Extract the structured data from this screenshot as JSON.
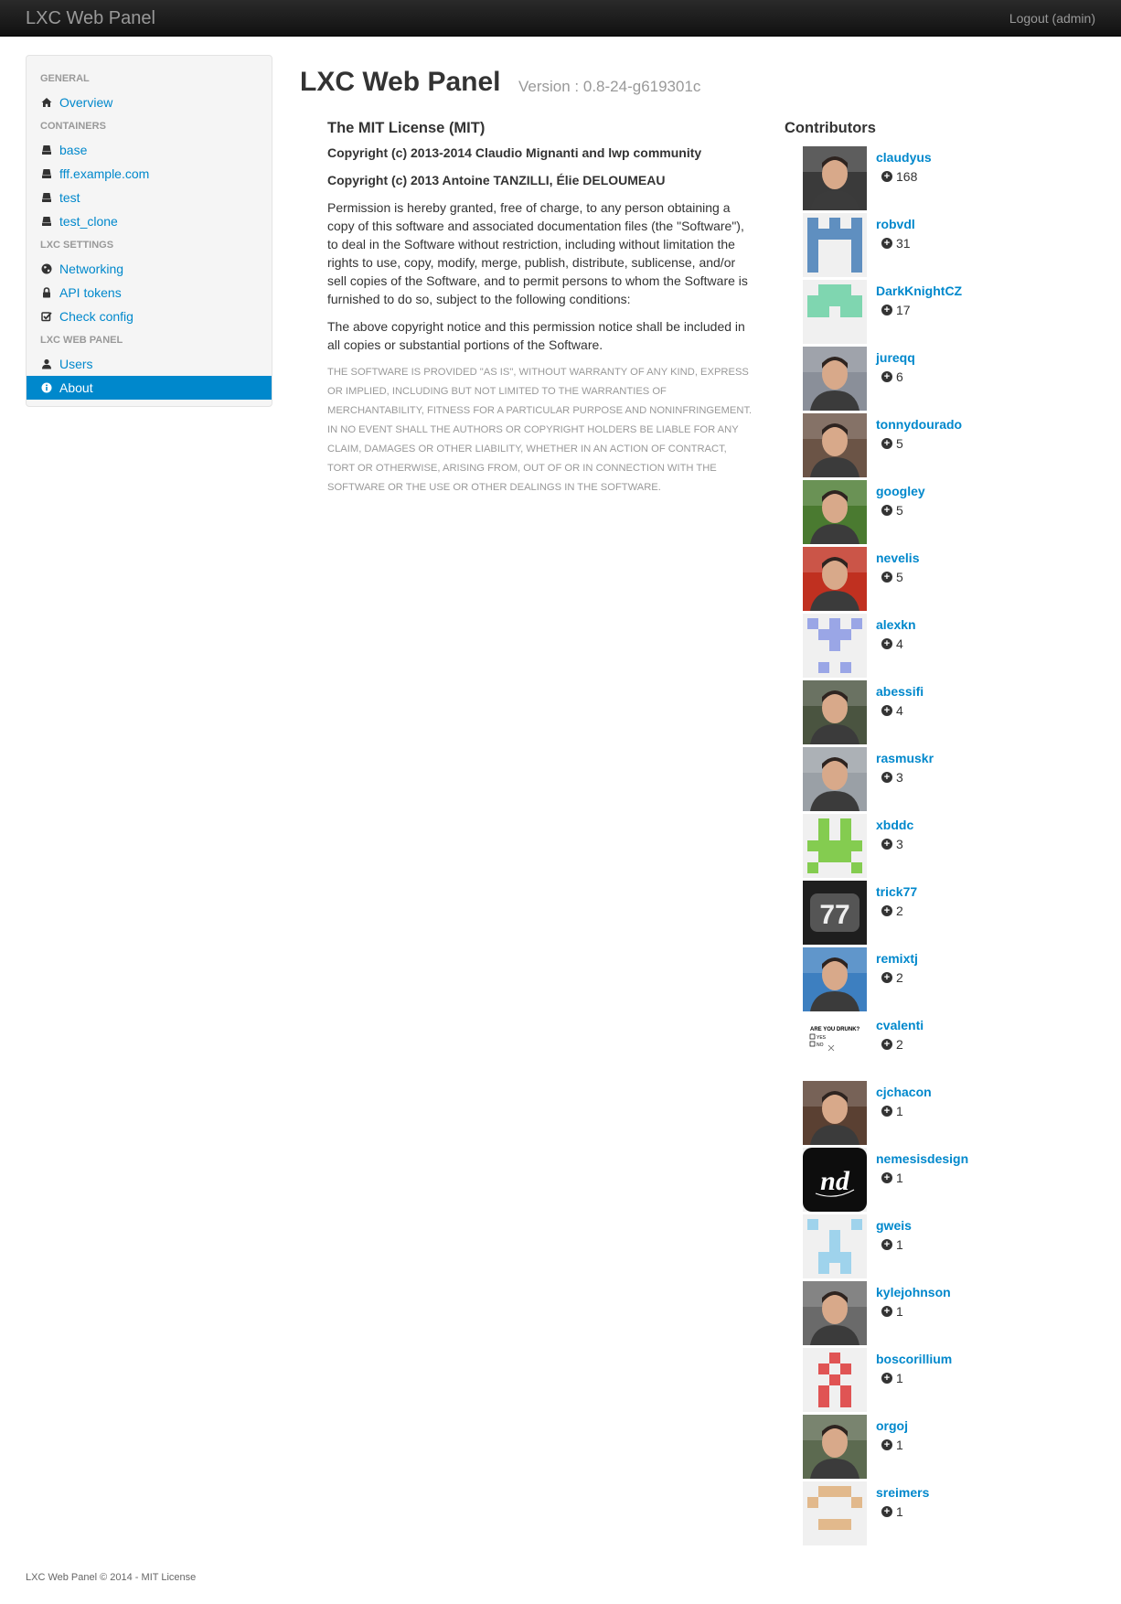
{
  "navbar": {
    "brand": "LXC Web Panel",
    "logout_label": "Logout (admin)"
  },
  "sidebar": {
    "sections": [
      {
        "header": "GENERAL",
        "items": [
          {
            "label": "Overview",
            "icon": "home-icon"
          }
        ]
      },
      {
        "header": "CONTAINERS",
        "items": [
          {
            "label": "base",
            "icon": "hdd-icon"
          },
          {
            "label": "fff.example.com",
            "icon": "hdd-icon"
          },
          {
            "label": "test",
            "icon": "hdd-icon"
          },
          {
            "label": "test_clone",
            "icon": "hdd-icon"
          }
        ]
      },
      {
        "header": "LXC SETTINGS",
        "items": [
          {
            "label": "Networking",
            "icon": "globe-icon"
          },
          {
            "label": "API tokens",
            "icon": "lock-icon"
          },
          {
            "label": "Check config",
            "icon": "check-icon"
          }
        ]
      },
      {
        "header": "LXC WEB PANEL",
        "items": [
          {
            "label": "Users",
            "icon": "user-icon"
          },
          {
            "label": "About",
            "icon": "info-icon",
            "active": true
          }
        ]
      }
    ],
    "active_color": "#0088cc"
  },
  "page": {
    "title": "LXC Web Panel",
    "version": "Version : 0.8-24-g619301c"
  },
  "license": {
    "title": "The MIT License (MIT)",
    "copyright_1": "Copyright (c) 2013-2014 Claudio Mignanti and lwp community",
    "copyright_2": "Copyright (c) 2013 Antoine TANZILLI, Élie DELOUMEAU",
    "permission": "Permission is hereby granted, free of charge, to any person obtaining a copy of this software and associated documentation files (the \"Software\"), to deal in the Software without restriction, including without limitation the rights to use, copy, modify, merge, publish, distribute, sublicense, and/or sell copies of the Software, and to permit persons to whom the Software is furnished to do so, subject to the following conditions:",
    "notice": "The above copyright notice and this permission notice shall be included in all copies or substantial portions of the Software.",
    "warranty": "THE SOFTWARE IS PROVIDED \"AS IS\", WITHOUT WARRANTY OF ANY KIND, EXPRESS OR IMPLIED, INCLUDING BUT NOT LIMITED TO THE WARRANTIES OF MERCHANTABILITY, FITNESS FOR A PARTICULAR PURPOSE AND NONINFRINGEMENT. IN NO EVENT SHALL THE AUTHORS OR COPYRIGHT HOLDERS BE LIABLE FOR ANY CLAIM, DAMAGES OR OTHER LIABILITY, WHETHER IN AN ACTION OF CONTRACT, TORT OR OTHERWISE, ARISING FROM, OUT OF OR IN CONNECTION WITH THE SOFTWARE OR THE USE OR OTHER DEALINGS IN THE SOFTWARE."
  },
  "contributors": {
    "title": "Contributors",
    "items": [
      {
        "name": "claudyus",
        "count": "168",
        "avatar": "photo",
        "color": "#3a3a3a"
      },
      {
        "name": "robvdl",
        "count": "31",
        "avatar": "identicon",
        "color": "#5f8fc0"
      },
      {
        "name": "DarkKnightCZ",
        "count": "17",
        "avatar": "identicon",
        "color": "#7fd6b0"
      },
      {
        "name": "jureqq",
        "count": "6",
        "avatar": "photo",
        "color": "#8a8f99"
      },
      {
        "name": "tonnydourado",
        "count": "5",
        "avatar": "photo",
        "color": "#6b5446"
      },
      {
        "name": "googley",
        "count": "5",
        "avatar": "photo",
        "color": "#4a7a30"
      },
      {
        "name": "nevelis",
        "count": "5",
        "avatar": "photo",
        "color": "#c03020"
      },
      {
        "name": "alexkn",
        "count": "4",
        "avatar": "identicon",
        "color": "#9aa6e6"
      },
      {
        "name": "abessifi",
        "count": "4",
        "avatar": "photo",
        "color": "#4a5440"
      },
      {
        "name": "rasmuskr",
        "count": "3",
        "avatar": "photo",
        "color": "#9aa0a6"
      },
      {
        "name": "xbddc",
        "count": "3",
        "avatar": "identicon",
        "color": "#84cc50"
      },
      {
        "name": "trick77",
        "count": "2",
        "avatar": "badge",
        "color": "#222222"
      },
      {
        "name": "remixtj",
        "count": "2",
        "avatar": "photo",
        "color": "#3d7fc0"
      },
      {
        "name": "cvalenti",
        "count": "2",
        "avatar": "drunk",
        "color": "#ffffff"
      },
      {
        "name": "cjchacon",
        "count": "1",
        "avatar": "photo",
        "color": "#5a4032"
      },
      {
        "name": "nemesisdesign",
        "count": "1",
        "avatar": "nd",
        "color": "#111111"
      },
      {
        "name": "gweis",
        "count": "1",
        "avatar": "identicon",
        "color": "#9fd3ec"
      },
      {
        "name": "kylejohnson",
        "count": "1",
        "avatar": "photo",
        "color": "#6a6a6a"
      },
      {
        "name": "boscorillium",
        "count": "1",
        "avatar": "identicon",
        "color": "#e05454"
      },
      {
        "name": "orgoj",
        "count": "1",
        "avatar": "photo",
        "color": "#5c6a50"
      },
      {
        "name": "sreimers",
        "count": "1",
        "avatar": "identicon",
        "color": "#e2b98c"
      }
    ],
    "trick77_text": "77",
    "cvalenti_lines": [
      "ARE YOU DRUNK?",
      "YES",
      "NO"
    ],
    "nemesisdesign_text": "nd"
  },
  "footer": {
    "text": "LXC Web Panel © 2014 - MIT License"
  }
}
